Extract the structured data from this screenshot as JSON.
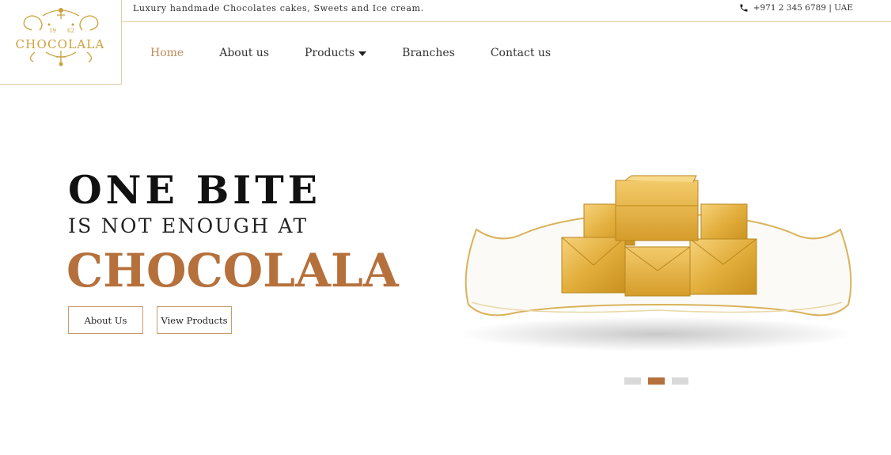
{
  "logo": {
    "text": "CHOCOLALA",
    "year_left": "19",
    "year_right": "62"
  },
  "topbar": {
    "tagline": "Luxury handmade Chocolates cakes, Sweets and Ice cream.",
    "phone": "+971 2 345 6789 | UAE"
  },
  "nav": {
    "items": [
      {
        "label": "Home"
      },
      {
        "label": "About us"
      },
      {
        "label": "Products"
      },
      {
        "label": "Branches"
      },
      {
        "label": "Contact us"
      }
    ]
  },
  "hero": {
    "line1": "ONE BITE",
    "line2": "IS NOT ENOUGH AT",
    "line3": "CHOCOLALA",
    "about_button": "About Us",
    "products_button": "View Products"
  },
  "slider": {
    "active_index": 1,
    "count": 3
  },
  "colors": {
    "accent": "#b5703c",
    "gold": "#d4a42a",
    "border": "#e0cfa6"
  }
}
